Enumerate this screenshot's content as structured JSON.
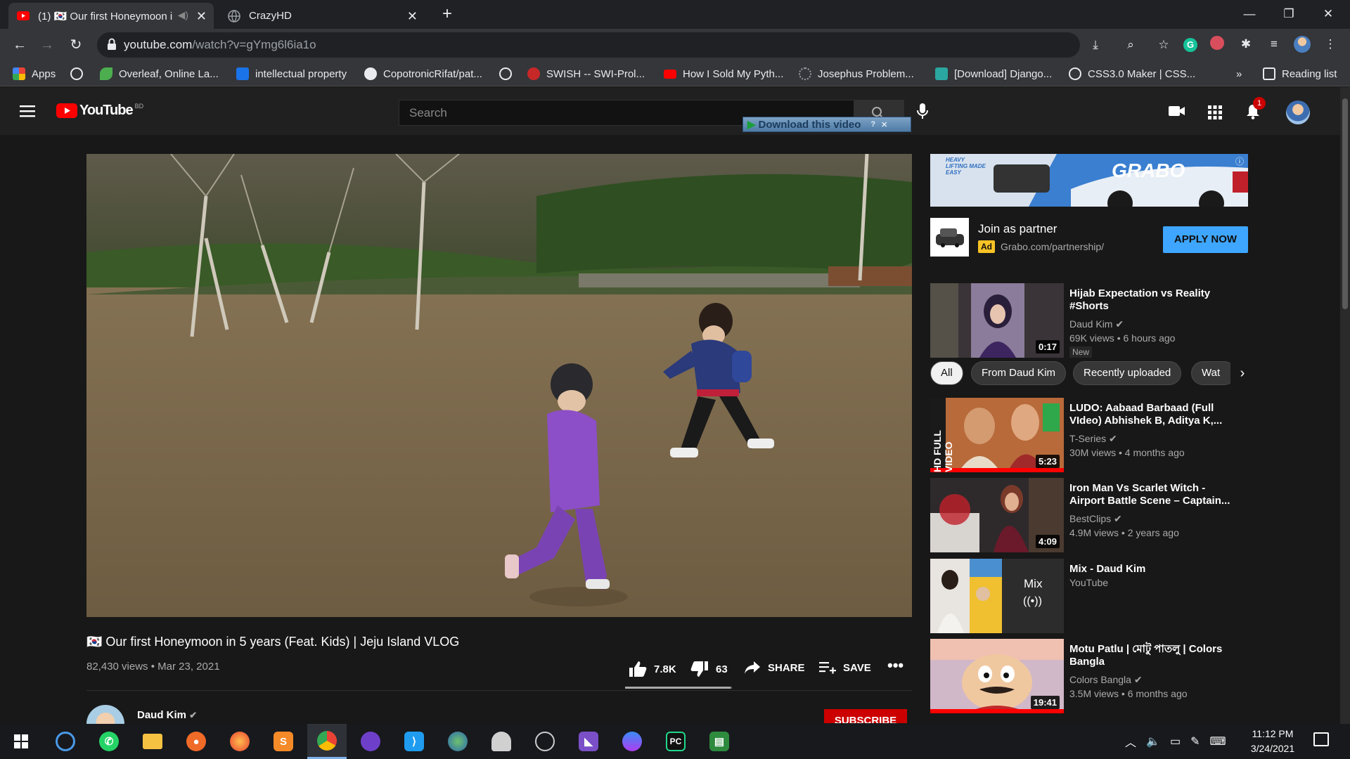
{
  "browser": {
    "tabs": [
      {
        "title": "(1) 🇰🇷 Our first Honeymoon i",
        "active": true
      },
      {
        "title": "CrazyHD",
        "active": false
      }
    ],
    "url_host": "youtube.com",
    "url_path": "/watch?v=gYmg6l6ia1o",
    "bookmarks": [
      "Apps",
      "Overleaf, Online La...",
      "intellectual property",
      "CopotronicRifat/pat...",
      "SWISH -- SWI-Prol...",
      "How I Sold My Pyth...",
      "Josephus Problem...",
      "[Download] Django...",
      "CSS3.0 Maker | CSS..."
    ],
    "reading_list": "Reading list",
    "more": "»"
  },
  "youtube": {
    "logo_text": "YouTube",
    "country": "BD",
    "search_placeholder": "Search",
    "download_bar": "Download this video",
    "notification_count": "1"
  },
  "video": {
    "title": "🇰🇷 Our first Honeymoon in 5 years (Feat. Kids) | Jeju Island VLOG",
    "views": "82,430 views",
    "date": "Mar 23, 2021",
    "likes": "7.8K",
    "dislikes": "63",
    "like_ratio": 0.99,
    "share_label": "SHARE",
    "save_label": "SAVE",
    "channel": "Daud Kim",
    "subscribe_label": "SUBSCRIBE"
  },
  "ad": {
    "banner_text": "GRABO",
    "banner_tagline": "HEAVY LIFTING MADE EASY",
    "title": "Join as partner",
    "badge": "Ad",
    "url": "Grabo.com/partnership/",
    "cta": "APPLY NOW"
  },
  "chips": [
    "All",
    "From Daud Kim",
    "Recently uploaded",
    "Wat"
  ],
  "sidebar_videos": [
    {
      "title": "Hijab Expectation vs Reality #Shorts",
      "channel": "Daud Kim",
      "verified": true,
      "meta": "69K views • 6 hours ago",
      "badge": "New",
      "duration": "0:17"
    },
    {
      "title": "LUDO: Aabaad Barbaad (Full VIdeo) Abhishek B, Aditya K,...",
      "channel": "T-Series",
      "verified": true,
      "meta": "30M views • 4 months ago",
      "duration": "5:23"
    },
    {
      "title": "Iron Man Vs Scarlet Witch - Airport Battle Scene – Captain...",
      "channel": "BestClips",
      "verified": true,
      "meta": "4.9M views • 2 years ago",
      "duration": "4:09"
    },
    {
      "title": "Mix - Daud Kim",
      "channel": "YouTube",
      "verified": false,
      "meta": "",
      "duration": "",
      "mix_label": "Mix"
    },
    {
      "title": "Motu Patlu | মোটু পাতলু | Colors Bangla",
      "channel": "Colors Bangla",
      "verified": true,
      "meta": "3.5M views • 6 months ago",
      "duration": "19:41"
    }
  ],
  "taskbar": {
    "time": "11:12 PM",
    "date": "3/24/2021"
  },
  "colors": {
    "youtube_red": "#ff0000",
    "apply_blue": "#3ea6ff",
    "subscribe_red": "#cc0000"
  }
}
